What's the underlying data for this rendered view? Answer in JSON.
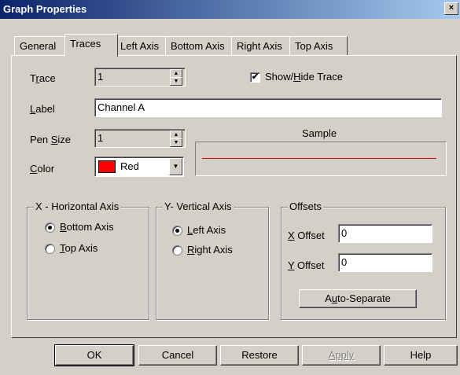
{
  "window": {
    "title": "Graph Properties",
    "close_glyph": "×"
  },
  "tabs": [
    {
      "label": "General"
    },
    {
      "label": "Traces"
    },
    {
      "label": "Left Axis"
    },
    {
      "label": "Bottom Axis"
    },
    {
      "label": "Right Axis"
    },
    {
      "label": "Top Axis"
    }
  ],
  "active_tab": "Traces",
  "trace": {
    "trace_label_pre": "T",
    "trace_label_ul": "r",
    "trace_label_post": "ace",
    "trace_value": "1",
    "show_hide_pre": "Show/",
    "show_hide_ul": "H",
    "show_hide_post": "ide Trace",
    "show_hide_checked": true,
    "label_label_ul": "L",
    "label_label_post": "abel",
    "label_value": "Channel A",
    "pen_label_pre": "Pen ",
    "pen_label_ul": "S",
    "pen_label_post": "ize",
    "pen_value": "1",
    "color_label_ul": "C",
    "color_label_post": "olor",
    "color_value": "Red",
    "color_swatch": "#ff0000",
    "sample_label": "Sample",
    "sample_line_color": "#e00000"
  },
  "x_axis_group": {
    "title": "X - Horizontal Axis",
    "opt1_ul": "B",
    "opt1_post": "ottom Axis",
    "opt1_selected": true,
    "opt2_ul": "T",
    "opt2_post": "op Axis",
    "opt2_selected": false
  },
  "y_axis_group": {
    "title": "Y- Vertical Axis",
    "opt1_ul": "L",
    "opt1_post": "eft Axis",
    "opt1_selected": true,
    "opt2_ul": "R",
    "opt2_post": "ight Axis",
    "opt2_selected": false
  },
  "offsets_group": {
    "title": "Offsets",
    "x_ul": "X",
    "x_post": " Offset",
    "x_value": "0",
    "y_ul": "Y",
    "y_post": " Offset",
    "y_value": "0",
    "auto_pre": "A",
    "auto_ul": "u",
    "auto_post": "to-Separate"
  },
  "buttons": {
    "ok": "OK",
    "cancel": "Cancel",
    "restore": "Restore",
    "apply": "Apply",
    "help": "Help"
  },
  "icons": {
    "spin_up": "▲",
    "spin_down": "▼",
    "dropdown": "▼",
    "check": "✔"
  }
}
